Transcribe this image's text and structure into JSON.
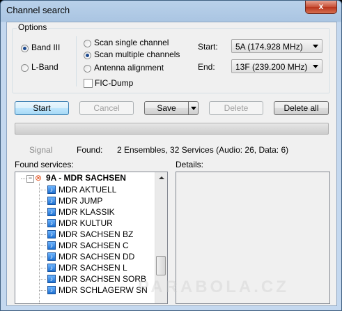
{
  "window": {
    "title": "Channel search",
    "close_glyph": "x"
  },
  "options": {
    "legend": "Options",
    "band_iii": "Band III",
    "l_band": "L-Band",
    "scan_single": "Scan single channel",
    "scan_multiple": "Scan multiple channels",
    "antenna": "Antenna alignment",
    "fic_dump": "FIC-Dump",
    "start_label": "Start:",
    "start_value": "5A (174.928 MHz)",
    "end_label": "End:",
    "end_value": "13F (239.200 MHz)"
  },
  "buttons": {
    "start": "Start",
    "cancel": "Cancel",
    "save": "Save",
    "delete": "Delete",
    "delete_all": "Delete all"
  },
  "status": {
    "signal": "Signal",
    "found_label": "Found:",
    "found_value": "2 Ensembles, 32 Services (Audio: 26, Data: 6)"
  },
  "services": {
    "label": "Found services:",
    "ensemble": "9A - MDR SACHSEN",
    "items": [
      "MDR AKTUELL",
      "MDR JUMP",
      "MDR KLASSIK",
      "MDR KULTUR",
      "MDR SACHSEN BZ",
      "MDR SACHSEN C",
      "MDR SACHSEN DD",
      "MDR SACHSEN L",
      "MDR SACHSEN SORB",
      "MDR SCHLAGERW SN"
    ]
  },
  "details": {
    "label": "Details:"
  },
  "watermark": "PARABOLA.CZ",
  "colors": {
    "accent": "#3c7fb1",
    "title_bar": "#b9d1ea",
    "close": "#c74f36"
  }
}
